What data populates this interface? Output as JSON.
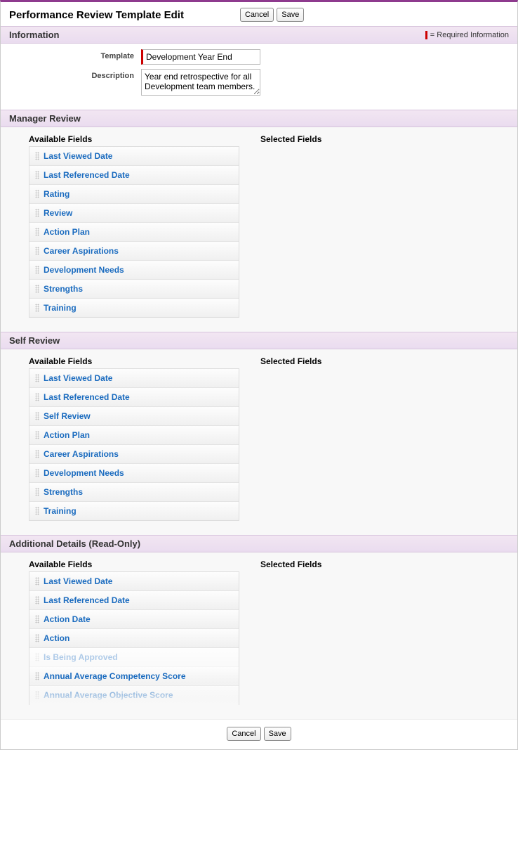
{
  "page_title": "Performance Review Template Edit",
  "buttons": {
    "cancel": "Cancel",
    "save": "Save"
  },
  "information": {
    "header": "Information",
    "required_legend": "= Required Information",
    "template_label": "Template",
    "template_value": "Development Year End",
    "description_label": "Description",
    "description_value": "Year end retrospective for all Development team members."
  },
  "column_labels": {
    "available": "Available Fields",
    "selected": "Selected Fields"
  },
  "sections": {
    "manager_review": {
      "header": "Manager Review",
      "available": [
        "Last Viewed Date",
        "Last Referenced Date",
        "Rating",
        "Review",
        "Action Plan",
        "Career Aspirations",
        "Development Needs",
        "Strengths",
        "Training"
      ],
      "selected": []
    },
    "self_review": {
      "header": "Self Review",
      "available": [
        "Last Viewed Date",
        "Last Referenced Date",
        "Self Review",
        "Action Plan",
        "Career Aspirations",
        "Development Needs",
        "Strengths",
        "Training"
      ],
      "selected": []
    },
    "additional_details": {
      "header": "Additional Details (Read-Only)",
      "available": [
        "Last Viewed Date",
        "Last Referenced Date",
        "Action Date",
        "Action",
        "Is Being Approved",
        "Annual Average Competency Score",
        "Annual Average Objective Score"
      ],
      "selected": []
    }
  }
}
